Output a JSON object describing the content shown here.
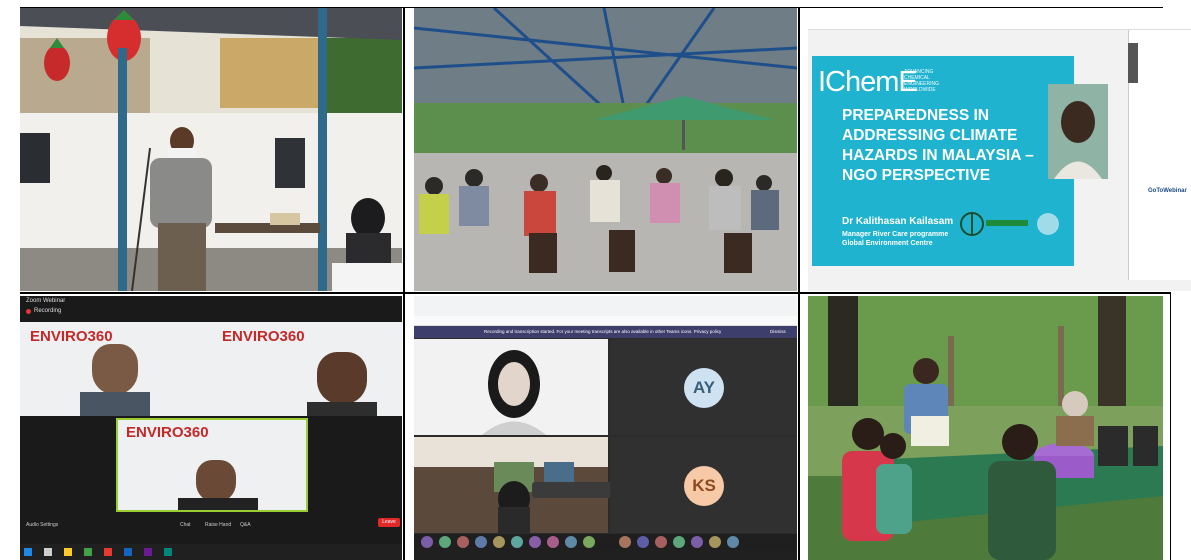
{
  "slide": {
    "logo_text": "IChemE",
    "logo_sub": "ADVANCING CHEMICAL ENGINEERING WORLDWIDE",
    "title": "PREPAREDNESS IN ADDRESSING CLIMATE HAZARDS IN MALAYSIA – NGO PERSPECTIVE",
    "speaker": "Dr Kalithasan Kailasam",
    "role_line1": "Manager River Care programme",
    "role_line2": "Global Environment Centre",
    "panel_brand": "GoToWebinar",
    "colors": {
      "slide_bg": "#1fb3cf"
    }
  },
  "zoom": {
    "window_title": "Zoom Webinar",
    "recording": "Recording",
    "enviro": "ENVIRO360",
    "leave": "Leave",
    "audio_settings": "Audio Settings",
    "chat": "Chat",
    "raise_hand": "Raise Hand",
    "q_and_a": "Q&A"
  },
  "teams": {
    "banner": "Recording and transcription started. For your meeting transcripts are also available in other Teams icons. Privacy policy",
    "dismiss": "Dismiss",
    "avatar_1": "AY",
    "avatar_2": "KS",
    "colors": {
      "avatar_1_bg": "#cfe2f2",
      "avatar_1_fg": "#3a5d7a",
      "avatar_2_bg": "#f7c9a6",
      "avatar_2_fg": "#8a4a1f"
    }
  }
}
